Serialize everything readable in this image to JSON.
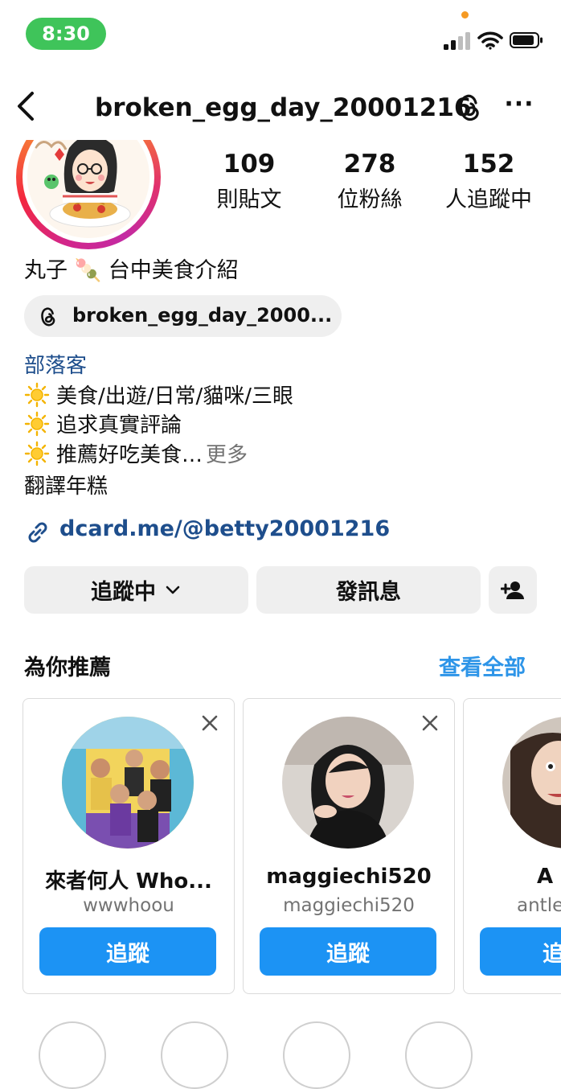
{
  "status_bar": {
    "time": "8:30"
  },
  "header": {
    "username": "broken_egg_day_20001216",
    "back_icon": "chevron-left-icon",
    "more_icon": "more-horizontal-icon"
  },
  "stats": [
    {
      "value": "109",
      "label": "則貼文"
    },
    {
      "value": "278",
      "label": "位粉絲"
    },
    {
      "value": "152",
      "label": "人追蹤中"
    }
  ],
  "profile": {
    "name": "丸子 🍡 台中美食介紹",
    "threads_handle": "broken_egg_day_2000...",
    "category": "部落客",
    "bio": [
      {
        "text": "美食/出遊/日常/貓咪/三眼"
      },
      {
        "text": "追求真實評論"
      },
      {
        "text": "推薦好吃美食…",
        "more": "更多"
      }
    ],
    "translate": "翻譯年糕",
    "link": "dcard.me/@betty20001216"
  },
  "actions": {
    "following": "追蹤中",
    "message": "發訊息",
    "add_user_icon": "person-add-icon"
  },
  "suggestions": {
    "title": "為你推薦",
    "see_all": "查看全部",
    "cards": [
      {
        "name": "來者何人 Who...",
        "handle": "wwwhoou",
        "follow": "追蹤"
      },
      {
        "name": "maggiechi520",
        "handle": "maggiechi520",
        "follow": "追蹤"
      },
      {
        "name": "A",
        "handle": "antle",
        "follow": "追"
      }
    ]
  },
  "colors": {
    "accent_blue": "#1c93f4",
    "link_blue": "#1e4e8c",
    "status_green": "#3fc45a"
  }
}
